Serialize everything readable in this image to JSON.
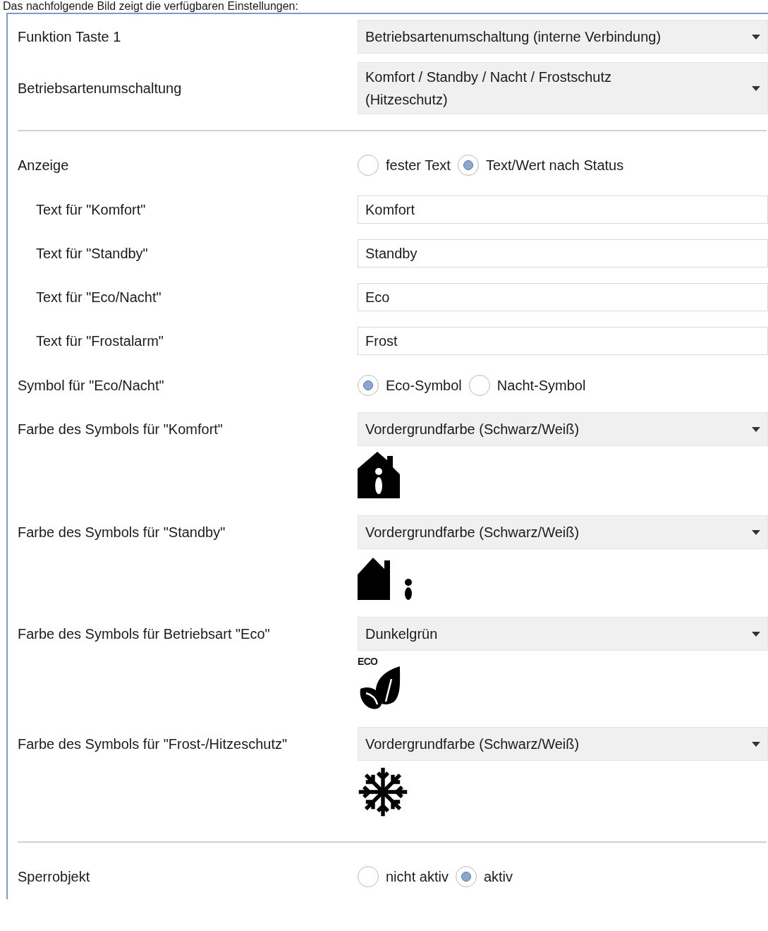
{
  "caption": "Das nachfolgende Bild zeigt die verfügbaren Einstellungen:",
  "settings": [
    {
      "kind": "dropdown",
      "label": "Funktion Taste 1",
      "value": "Betriebsartenumschaltung (interne Verbindung)"
    },
    {
      "kind": "dropdown",
      "label": "Betriebsartenumschaltung",
      "value": "Komfort / Standby / Nacht / Frostschutz (Hitzeschutz)"
    },
    {
      "kind": "divider"
    },
    {
      "kind": "radio",
      "label": "Anzeige",
      "options": [
        {
          "label": "fester Text",
          "selected": false
        },
        {
          "label": "Text/Wert nach Status",
          "selected": true
        }
      ],
      "children": [
        {
          "kind": "text",
          "label": "Text für \"Komfort\"",
          "value": "Komfort"
        },
        {
          "kind": "text",
          "label": "Text für \"Standby\"",
          "value": "Standby"
        },
        {
          "kind": "text",
          "label": "Text für \"Eco/Nacht\"",
          "value": "Eco"
        },
        {
          "kind": "text",
          "label": "Text für \"Frostalarm\"",
          "value": "Frost"
        }
      ]
    },
    {
      "kind": "radio",
      "label": "Symbol für \"Eco/Nacht\"",
      "options": [
        {
          "label": "Eco-Symbol",
          "selected": true
        },
        {
          "label": "Nacht-Symbol",
          "selected": false
        }
      ]
    },
    {
      "kind": "dropdown",
      "label": "Farbe des Symbols für \"Komfort\"",
      "value": "Vordergrundfarbe (Schwarz/Weiß)"
    },
    {
      "kind": "symbol"
    },
    {
      "kind": "dropdown",
      "label": "Farbe des Symbols für \"Standby\"",
      "value": "Vordergrundfarbe (Schwarz/Weiß)"
    },
    {
      "kind": "symbol"
    },
    {
      "kind": "dropdown",
      "label": "Farbe des Symbols für Betriebsart \"Eco\"",
      "value": "Dunkelgrün"
    },
    {
      "kind": "symbol",
      "label": "ECO"
    },
    {
      "kind": "dropdown",
      "label": "Farbe des Symbols für \"Frost-/Hitzeschutz\"",
      "value": "Vordergrundfarbe (Schwarz/Weiß)"
    },
    {
      "kind": "symbol"
    },
    {
      "kind": "divider"
    },
    {
      "kind": "radio",
      "label": "Sperrobjekt",
      "options": [
        {
          "label": "nicht aktiv",
          "selected": false
        },
        {
          "label": "aktiv",
          "selected": true
        }
      ]
    }
  ]
}
